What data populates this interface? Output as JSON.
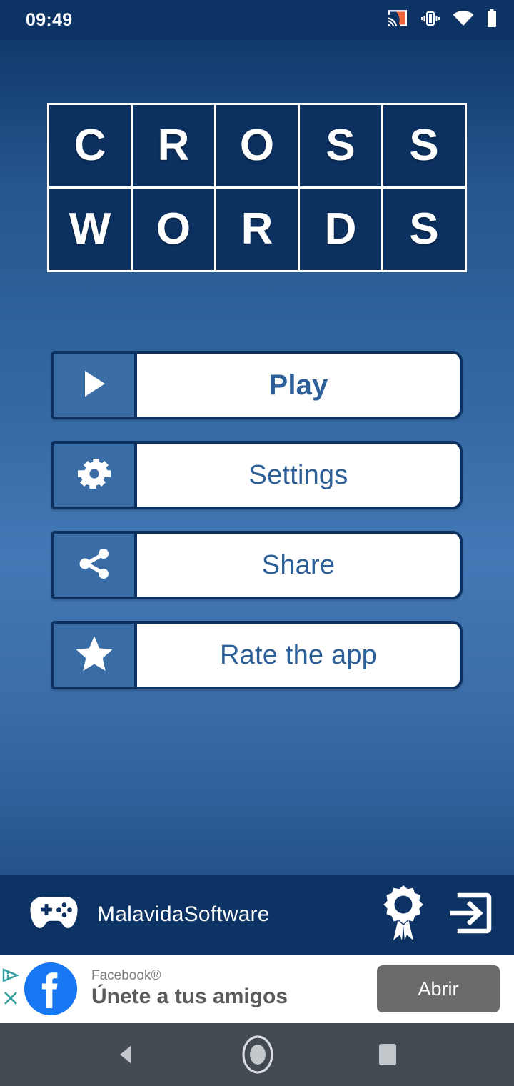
{
  "status_bar": {
    "clock": "09:49",
    "icons": [
      "cast-icon",
      "vibrate-icon",
      "wifi-icon",
      "battery-icon"
    ],
    "background": "#0c3363",
    "cast_accent": "#f4663c"
  },
  "logo": {
    "name": "crossword-logo",
    "rows": [
      [
        "C",
        "R",
        "O",
        "S",
        "S"
      ],
      [
        "W",
        "O",
        "R",
        "D",
        "S"
      ]
    ],
    "tile_color": "#0c3161",
    "grid_line_color": "#ffffff",
    "letter_color": "#ffffff"
  },
  "menu": {
    "items": [
      {
        "label": "Play",
        "icon": "play-icon",
        "name": "play-button",
        "primary": true
      },
      {
        "label": "Settings",
        "icon": "gear-icon",
        "name": "settings-button",
        "primary": false
      },
      {
        "label": "Share",
        "icon": "share-icon",
        "name": "share-button",
        "primary": false
      },
      {
        "label": "Rate the app",
        "icon": "star-icon",
        "name": "rate-the-app-button",
        "primary": false
      }
    ],
    "label_color": "#2d6099",
    "icon_box_color": "#3a6da6",
    "border_color": "#0c3161"
  },
  "footer": {
    "brand": "MalavidaSoftware",
    "brand_icon": "gamepad-icon",
    "actions": [
      "award-icon",
      "login-icon"
    ],
    "background": "#0c3363"
  },
  "ad": {
    "advertiser": "Facebook®",
    "headline": "Únete a tus amigos",
    "cta_label": "Abrir",
    "logo": "facebook-icon",
    "adchoices": [
      "adchoices-icon",
      "close-icon"
    ],
    "cta_color": "#6b6b6b",
    "brand_color": "#1877f2",
    "adchoices_color": "#2e9e9e"
  },
  "nav_bar": {
    "items": [
      "back-icon",
      "home-icon",
      "recents-icon"
    ],
    "background": "#434a51",
    "icon_color": "#c3c8cc"
  }
}
